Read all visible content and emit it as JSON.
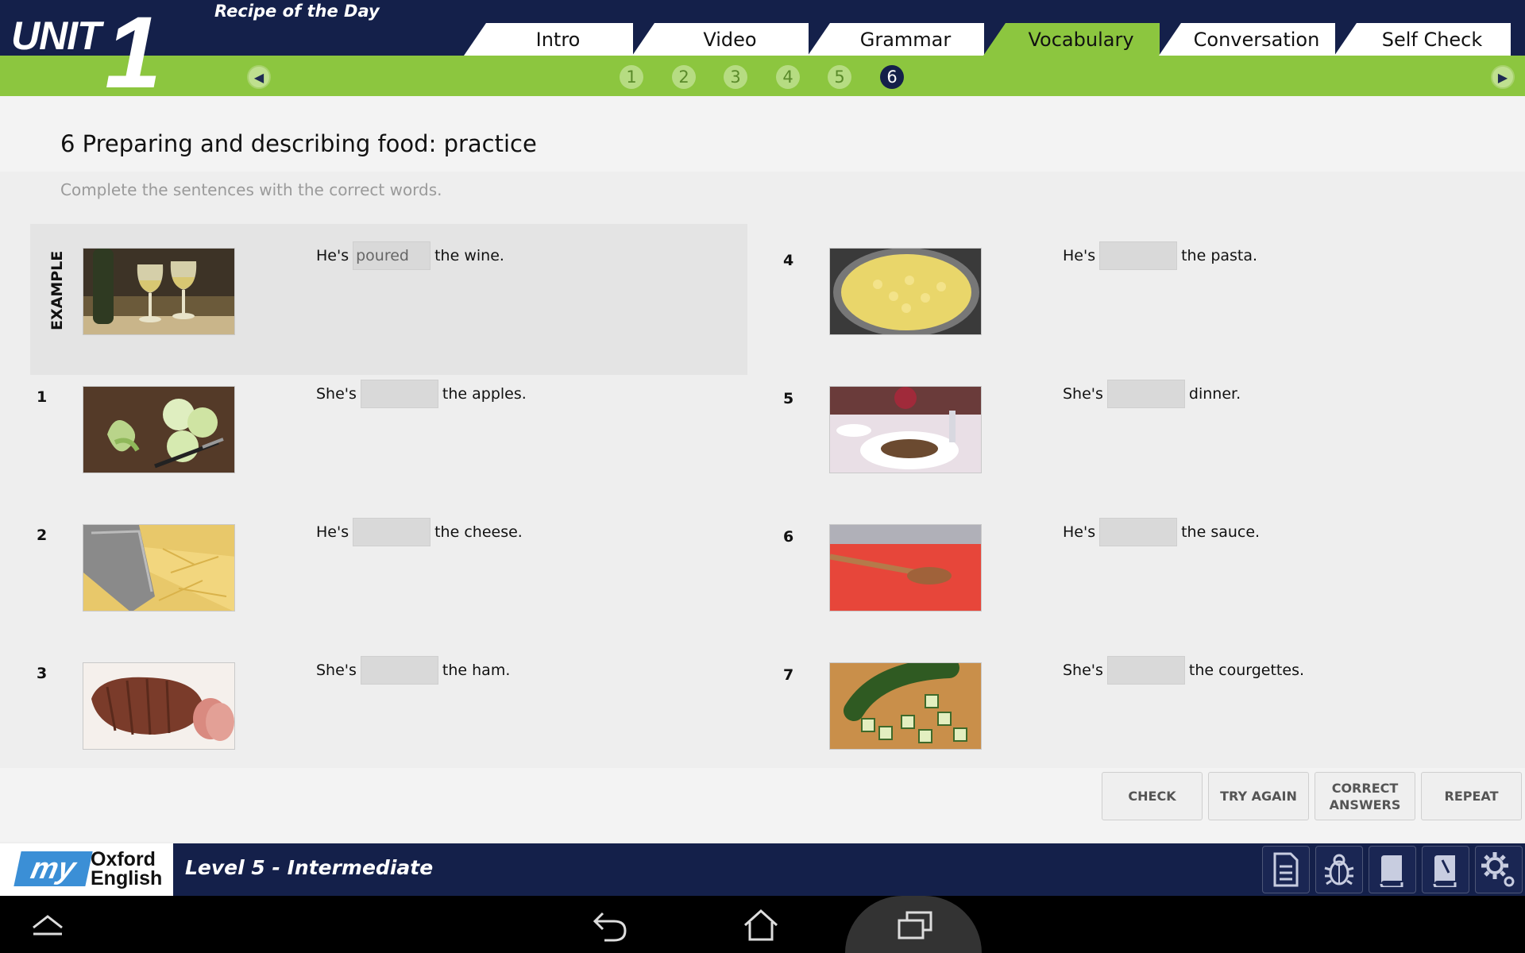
{
  "header": {
    "unit_label": "UNIT",
    "unit_number": "1",
    "title": "Recipe of the Day",
    "tabs": [
      {
        "label": "Intro",
        "active": false
      },
      {
        "label": "Video",
        "active": false
      },
      {
        "label": "Grammar",
        "active": false
      },
      {
        "label": "Vocabulary",
        "active": true
      },
      {
        "label": "Conversation",
        "active": false
      },
      {
        "label": "Self Check",
        "active": false
      }
    ],
    "pages": [
      "1",
      "2",
      "3",
      "4",
      "5",
      "6"
    ],
    "active_page": "6"
  },
  "exercise": {
    "title": "6 Preparing and describing food: practice",
    "instruction": "Complete the sentences with the correct words.",
    "example_label": "EXAMPLE",
    "items": [
      {
        "number": "",
        "before": "He's",
        "answer": "poured",
        "after": "the wine.",
        "image": "white-wine-glasses"
      },
      {
        "number": "1",
        "before": "She's",
        "answer": "",
        "after": "the apples.",
        "image": "peeled-apples"
      },
      {
        "number": "2",
        "before": "He's",
        "answer": "",
        "after": "the cheese.",
        "image": "grated-cheese"
      },
      {
        "number": "3",
        "before": "She's",
        "answer": "",
        "after": "the ham.",
        "image": "sliced-ham"
      },
      {
        "number": "4",
        "before": "He's",
        "answer": "",
        "after": "the pasta.",
        "image": "pasta-pan"
      },
      {
        "number": "5",
        "before": "She's",
        "answer": "",
        "after": "dinner.",
        "image": "dinner-table"
      },
      {
        "number": "6",
        "before": "He's",
        "answer": "",
        "after": "the sauce.",
        "image": "tomato-sauce"
      },
      {
        "number": "7",
        "before": "She's",
        "answer": "",
        "after": "the courgettes.",
        "image": "chopped-courgettes"
      }
    ]
  },
  "actions": {
    "check": "CHECK",
    "try_again": "TRY AGAIN",
    "correct_answers_1": "CORRECT",
    "correct_answers_2": "ANSWERS",
    "repeat": "REPEAT"
  },
  "footer": {
    "logo_my": "my",
    "logo_oxford": "Oxford",
    "logo_english": "English",
    "level": "Level 5 - Intermediate",
    "tools": [
      "document-icon",
      "bug-icon",
      "book-icon",
      "workbook-icon",
      "settings-icon"
    ]
  },
  "colors": {
    "navy": "#14204a",
    "green": "#8cc63f",
    "blank": "#d9d9d9"
  }
}
